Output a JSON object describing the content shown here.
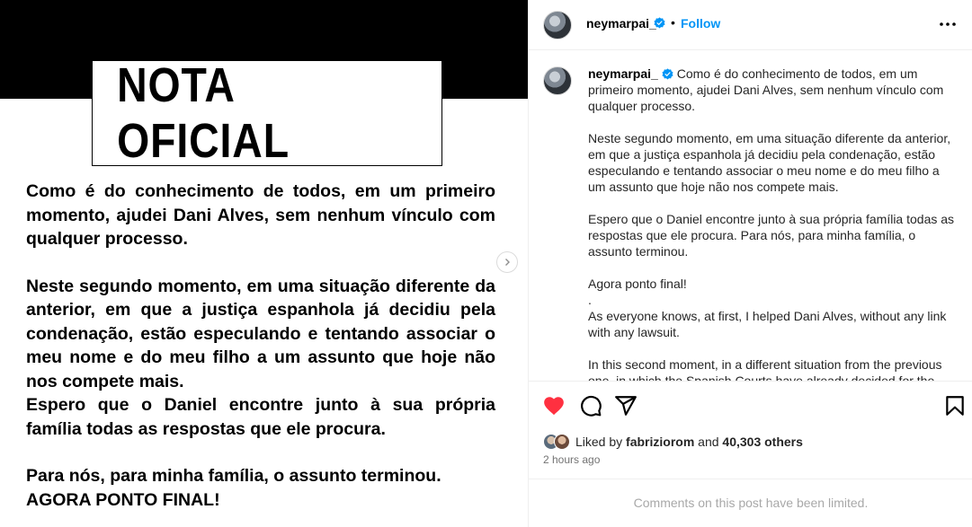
{
  "post_image": {
    "title": "NOTA  OFICIAL",
    "paragraphs": [
      "Como é do conhecimento de todos,  em um primeiro momento, ajudei Dani Alves, sem nenhum vínculo com qualquer processo.",
      "Neste segundo momento, em uma situação diferente da anterior, em que a justiça espanhola já decidiu pela condenação, estão especulando e tentando associar o meu nome e do meu filho a um assunto que hoje não nos compete mais.",
      "Espero que o Daniel encontre junto à sua própria família todas as respostas que ele procura.",
      "Para nós, para minha família, o assunto terminou.",
      "AGORA PONTO FINAL!"
    ]
  },
  "header": {
    "username": "neymarpai_",
    "separator": "•",
    "follow_label": "Follow",
    "more_icon": "more-horizontal-icon"
  },
  "caption": {
    "username": "neymarpai_",
    "lines": [
      "Como é do conhecimento de todos, em um primeiro momento, ajudei Dani Alves, sem nenhum vínculo com qualquer processo.",
      "Neste segundo momento, em uma situação diferente da anterior, em que a justiça espanhola já decidiu pela condenação, estão especulando e tentando associar o meu nome e do meu filho a um assunto que hoje não nos compete mais.",
      "Espero que o Daniel encontre junto à sua própria família todas as respostas que ele procura. Para nós, para minha família, o assunto terminou.",
      "Agora ponto final!",
      ".",
      "As everyone knows, at first, I helped Dani Alves, without any link with any lawsuit.",
      "In this second moment, in a different situation from the previous one, in which the Spanish Courts have already decided for the"
    ]
  },
  "engagement": {
    "liked_prefix": "Liked by",
    "liked_user": "fabriziorom",
    "liked_and": "and",
    "likes_count": "40,303 others",
    "time_ago": "2 hours ago",
    "comments_notice": "Comments on this post have been limited."
  },
  "colors": {
    "accent": "#0095f6",
    "heart": "#ff3040",
    "verified": "#0095f6"
  }
}
